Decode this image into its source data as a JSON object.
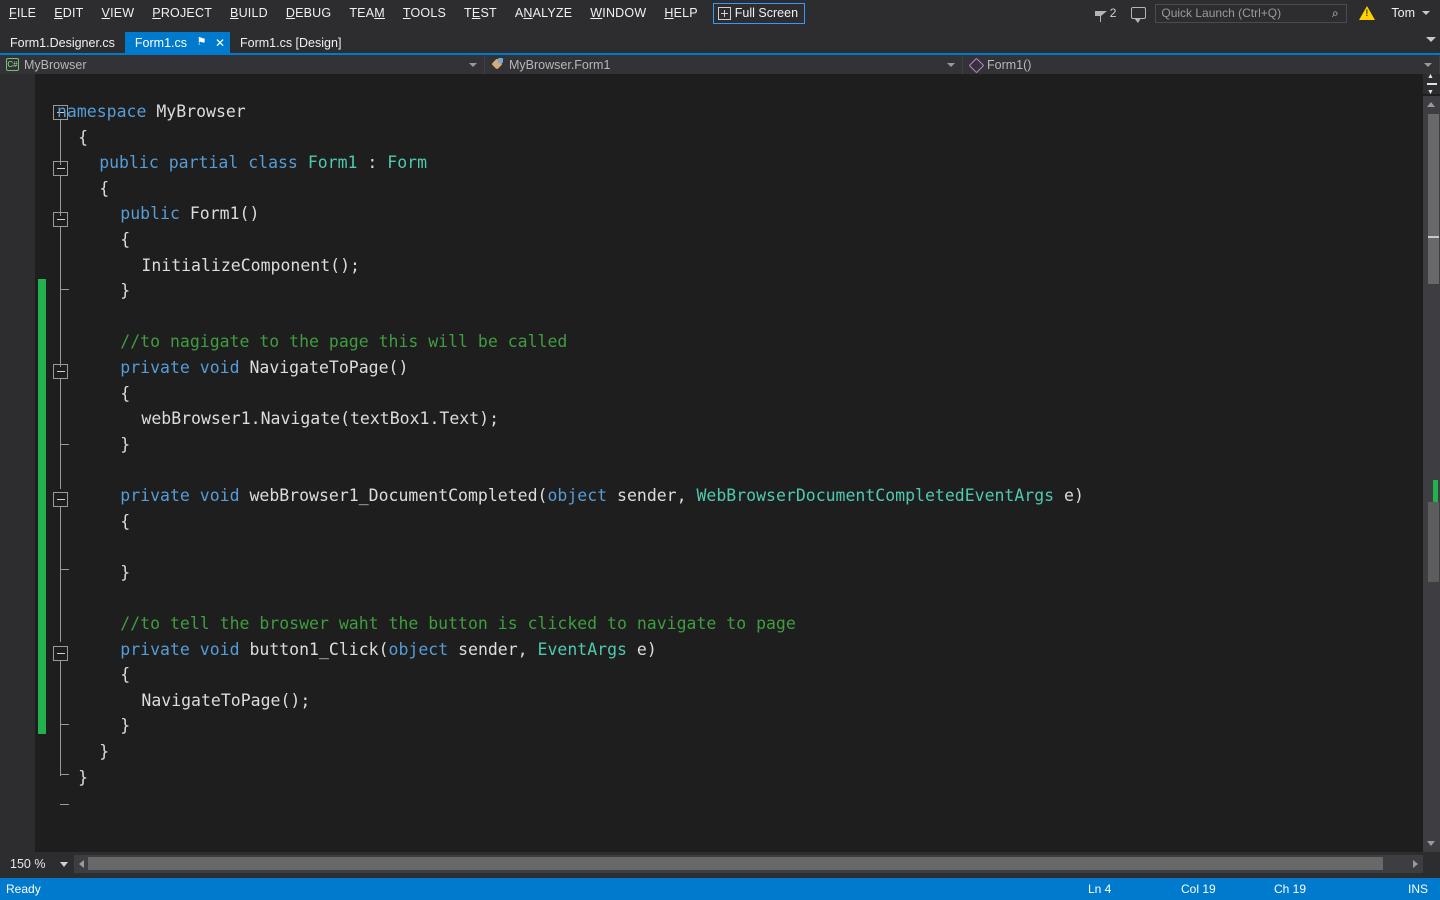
{
  "menubar": {
    "items": [
      {
        "label": "FILE",
        "accel_index": 0
      },
      {
        "label": "EDIT",
        "accel_index": 0
      },
      {
        "label": "VIEW",
        "accel_index": 0
      },
      {
        "label": "PROJECT",
        "accel_index": 0
      },
      {
        "label": "BUILD",
        "accel_index": 0
      },
      {
        "label": "DEBUG",
        "accel_index": 0
      },
      {
        "label": "TEAM",
        "accel_index": 3
      },
      {
        "label": "TOOLS",
        "accel_index": 0
      },
      {
        "label": "TEST",
        "accel_index": 1
      },
      {
        "label": "ANALYZE",
        "accel_index": 1
      },
      {
        "label": "WINDOW",
        "accel_index": 0
      },
      {
        "label": "HELP",
        "accel_index": 0
      }
    ],
    "fullscreen_label": "Full Screen",
    "notification_count": "2",
    "user": "Tom"
  },
  "quick_launch": {
    "placeholder": "Quick Launch (Ctrl+Q)",
    "value": "",
    "search_glyph": "⌕"
  },
  "tabs": [
    {
      "label": "Form1.Designer.cs",
      "active": false
    },
    {
      "label": "Form1.cs",
      "active": true,
      "pin": "⚑",
      "close": "✕"
    },
    {
      "label": "Form1.cs [Design]",
      "active": false
    }
  ],
  "navbar": {
    "project": "MyBrowser",
    "type": "MyBrowser.Form1",
    "member": "Form1()"
  },
  "editor": {
    "zoom": "150 %",
    "lines": [
      {
        "indent": 0,
        "tokens": [
          {
            "t": "k",
            "s": "namespace"
          },
          {
            "t": "p",
            "s": " MyBrowser"
          }
        ]
      },
      {
        "indent": 1,
        "tokens": [
          {
            "t": "p",
            "s": "{"
          }
        ]
      },
      {
        "indent": 2,
        "tokens": [
          {
            "t": "k",
            "s": "public partial class"
          },
          {
            "t": "p",
            "s": " "
          },
          {
            "t": "t",
            "s": "Form1"
          },
          {
            "t": "p",
            "s": " : "
          },
          {
            "t": "t",
            "s": "Form"
          }
        ]
      },
      {
        "indent": 2,
        "tokens": [
          {
            "t": "p",
            "s": "{"
          }
        ]
      },
      {
        "indent": 3,
        "tokens": [
          {
            "t": "k",
            "s": "public"
          },
          {
            "t": "p",
            "s": " Form1()"
          }
        ]
      },
      {
        "indent": 3,
        "tokens": [
          {
            "t": "p",
            "s": "{"
          }
        ]
      },
      {
        "indent": 4,
        "tokens": [
          {
            "t": "p",
            "s": "InitializeComponent();"
          }
        ]
      },
      {
        "indent": 3,
        "tokens": [
          {
            "t": "p",
            "s": "}"
          }
        ]
      },
      {
        "indent": 0,
        "tokens": []
      },
      {
        "indent": 3,
        "tokens": [
          {
            "t": "c",
            "s": "//to nagigate to the page this will be called"
          }
        ]
      },
      {
        "indent": 3,
        "tokens": [
          {
            "t": "k",
            "s": "private void"
          },
          {
            "t": "p",
            "s": " NavigateToPage()"
          }
        ]
      },
      {
        "indent": 3,
        "tokens": [
          {
            "t": "p",
            "s": "{"
          }
        ]
      },
      {
        "indent": 4,
        "tokens": [
          {
            "t": "p",
            "s": "webBrowser1.Navigate(textBox1.Text);"
          }
        ]
      },
      {
        "indent": 3,
        "tokens": [
          {
            "t": "p",
            "s": "}"
          }
        ]
      },
      {
        "indent": 0,
        "tokens": []
      },
      {
        "indent": 3,
        "tokens": [
          {
            "t": "k",
            "s": "private void"
          },
          {
            "t": "p",
            "s": " webBrowser1_DocumentCompleted("
          },
          {
            "t": "k",
            "s": "object"
          },
          {
            "t": "p",
            "s": " sender, "
          },
          {
            "t": "t",
            "s": "WebBrowserDocumentCompletedEventArgs"
          },
          {
            "t": "p",
            "s": " e)"
          }
        ]
      },
      {
        "indent": 3,
        "tokens": [
          {
            "t": "p",
            "s": "{"
          }
        ]
      },
      {
        "indent": 0,
        "tokens": []
      },
      {
        "indent": 3,
        "tokens": [
          {
            "t": "p",
            "s": "}"
          }
        ]
      },
      {
        "indent": 0,
        "tokens": []
      },
      {
        "indent": 3,
        "tokens": [
          {
            "t": "c",
            "s": "//to tell the broswer waht the button is clicked to navigate to page"
          }
        ]
      },
      {
        "indent": 3,
        "tokens": [
          {
            "t": "k",
            "s": "private void"
          },
          {
            "t": "p",
            "s": " button1_Click("
          },
          {
            "t": "k",
            "s": "object"
          },
          {
            "t": "p",
            "s": " sender, "
          },
          {
            "t": "t",
            "s": "EventArgs"
          },
          {
            "t": "p",
            "s": " e)"
          }
        ]
      },
      {
        "indent": 3,
        "tokens": [
          {
            "t": "p",
            "s": "{"
          }
        ]
      },
      {
        "indent": 4,
        "tokens": [
          {
            "t": "p",
            "s": "NavigateToPage();"
          }
        ]
      },
      {
        "indent": 3,
        "tokens": [
          {
            "t": "p",
            "s": "}"
          }
        ]
      },
      {
        "indent": 2,
        "tokens": [
          {
            "t": "p",
            "s": "}"
          }
        ]
      },
      {
        "indent": 1,
        "tokens": [
          {
            "t": "p",
            "s": "}"
          }
        ]
      }
    ]
  },
  "statusbar": {
    "ready": "Ready",
    "line": "Ln 4",
    "column": "Col 19",
    "character": "Ch 19",
    "insert_mode": "INS"
  },
  "colors": {
    "accent": "#007acc",
    "chrome": "#2d2d30",
    "editor_bg": "#1e1e1e",
    "keyword": "#569cd6",
    "type": "#4ec9b0",
    "comment": "#3f9d3f",
    "plain": "#dcdcdc",
    "change_bar": "#22b14c",
    "warning": "#ffd100"
  }
}
